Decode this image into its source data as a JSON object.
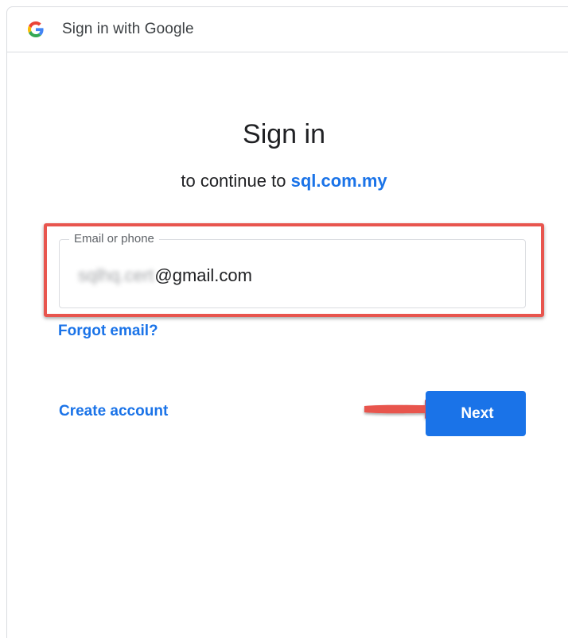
{
  "window": {
    "title": "Sign in with Google"
  },
  "signin": {
    "heading": "Sign in",
    "subheading_prefix": "to continue to",
    "domain": "sql.com.my"
  },
  "email_field": {
    "label": "Email or phone",
    "value_obscured": "sqlhq.cert",
    "value_visible": "@gmail.com"
  },
  "links": {
    "forgot_email": "Forgot email?",
    "create_account": "Create account"
  },
  "buttons": {
    "next": "Next"
  },
  "colors": {
    "accent": "#1a73e8",
    "highlight": "#e8554e",
    "border": "#dadce0"
  },
  "icons": {
    "logo": "google-g-icon",
    "annotation": "arrow-right-icon"
  }
}
